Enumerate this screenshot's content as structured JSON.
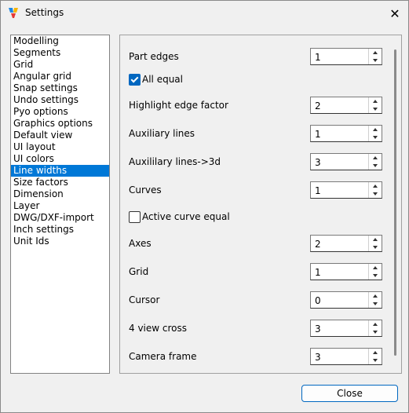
{
  "window": {
    "title": "Settings",
    "close_glyph": "✕"
  },
  "nav": {
    "items": [
      "Modelling",
      "Segments",
      "Grid",
      "Angular grid",
      "Snap settings",
      "Undo settings",
      "Pyo options",
      "Graphics options",
      "Default view",
      "UI layout",
      "UI colors",
      "Line widths",
      "Size factors",
      "Dimension",
      "Layer",
      "DWG/DXF-import",
      "Inch settings",
      "Unit Ids"
    ],
    "selected": "Line widths"
  },
  "fields": {
    "part_edges": {
      "label": "Part edges",
      "value": "1"
    },
    "all_equal": {
      "label": "All equal",
      "checked": true
    },
    "highlight_edge_factor": {
      "label": "Highlight edge factor",
      "value": "2"
    },
    "auxiliary_lines": {
      "label": "Auxiliary lines",
      "value": "1"
    },
    "auxiliary_lines_3d": {
      "label": "Auxililary lines->3d",
      "value": "3"
    },
    "curves": {
      "label": "Curves",
      "value": "1"
    },
    "active_curve_equal": {
      "label": "Active curve equal",
      "checked": false
    },
    "axes": {
      "label": "Axes",
      "value": "2"
    },
    "grid": {
      "label": "Grid",
      "value": "1"
    },
    "cursor": {
      "label": "Cursor",
      "value": "0"
    },
    "four_view_cross": {
      "label": "4 view cross",
      "value": "3"
    },
    "camera_frame": {
      "label": "Camera frame",
      "value": "3"
    }
  },
  "buttons": {
    "close": "Close"
  },
  "colors": {
    "accent": "#0078d7",
    "checkbox": "#0067c0"
  }
}
